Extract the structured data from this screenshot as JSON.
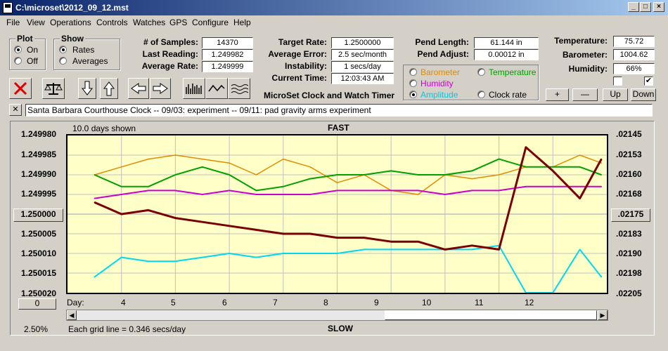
{
  "window": {
    "title": "C:\\microset\\2012_09_12.mst"
  },
  "menu": [
    "File",
    "View",
    "Operations",
    "Controls",
    "Watches",
    "GPS",
    "Configure",
    "Help"
  ],
  "plot_group": {
    "label": "Plot",
    "on": "On",
    "off": "Off",
    "selected": "On"
  },
  "show_group": {
    "label": "Show",
    "rates": "Rates",
    "averages": "Averages",
    "selected": "Rates"
  },
  "stats": {
    "samples_label": "# of Samples:",
    "samples": "14370",
    "last_label": "Last Reading:",
    "last": "1.249982",
    "avg_label": "Average Rate:",
    "avg": "1.249999"
  },
  "timing": {
    "target_label": "Target Rate:",
    "target": "1.2500000",
    "avg_err_label": "Average Error:",
    "avg_err": "2.5 sec/month",
    "instab_label": "Instability:",
    "instab": "1 secs/day",
    "time_label": "Current Time:",
    "time": "12:03:43 AM",
    "app_name": "MicroSet Clock and Watch Timer"
  },
  "pend": {
    "length_label": "Pend Length:",
    "length": "61.144 in",
    "adjust_label": "Pend Adjust:",
    "adjust": "0.00012 in"
  },
  "legend": {
    "barometer": "Barometer",
    "temperature": "Temperature",
    "humidity": "Humidity",
    "amplitude": "Amplitude",
    "clock_rate": "Clock rate",
    "colors": {
      "barometer": "#e08c00",
      "temperature": "#00a000",
      "humidity": "#cc00cc",
      "amplitude": "#00c8e0",
      "clock_rate": "#000000"
    }
  },
  "env": {
    "temp_label": "Temperature:",
    "temp": "75.72",
    "baro_label": "Barometer:",
    "baro": "1004.62",
    "hum_label": "Humidity:",
    "hum": "66%"
  },
  "scale_buttons": {
    "plus": "+",
    "minus": "—",
    "up": "Up",
    "down": "Down"
  },
  "notes": {
    "close": "✕",
    "text": "Santa Barbara Courthouse Clock  --  09/03: experiment  --  09/11: pad gravity arms experiment"
  },
  "plot": {
    "days_shown": "10.0 days shown",
    "fast": "FAST",
    "slow": "SLOW",
    "left_ticks": [
      "1.249980",
      "1.249985",
      "1.249990",
      "1.249995",
      "1.250000",
      "1.250005",
      "1.250010",
      "1.250015",
      "1.250020"
    ],
    "right_ticks": [
      ".02145",
      ".02153",
      ".02160",
      ".02168",
      ".02175",
      ".02183",
      ".02190",
      ".02198",
      ".02205"
    ],
    "center_left": "1.250000",
    "center_right": ".02175",
    "zero_btn": "0",
    "day_label": "Day:",
    "days": [
      "4",
      "5",
      "6",
      "7",
      "8",
      "9",
      "10",
      "11",
      "12"
    ],
    "zoom": "2.50%",
    "grid_note": "Each grid line = 0.346 secs/day",
    "colors": {
      "rate": "#7a0000",
      "barometer": "#e08c00",
      "temperature": "#00a000",
      "humidity": "#cc00cc",
      "amplitude": "#00d8f0",
      "bg": "#ffffc8"
    }
  },
  "chart_data": {
    "type": "line",
    "x": [
      3.5,
      4,
      4.5,
      5,
      5.5,
      6,
      6.5,
      7,
      7.5,
      8,
      8.5,
      9,
      9.5,
      10,
      10.5,
      11,
      11.5,
      12,
      12.5,
      12.9
    ],
    "series": [
      {
        "name": "Clock rate",
        "values": [
          1.249997,
          1.25,
          1.249999,
          1.250001,
          1.250002,
          1.250003,
          1.250004,
          1.250005,
          1.250005,
          1.250006,
          1.250006,
          1.250007,
          1.250007,
          1.250009,
          1.250008,
          1.250009,
          1.249983,
          1.249989,
          1.249996,
          1.249986
        ]
      },
      {
        "name": "Barometer",
        "values": [
          1.24999,
          1.249988,
          1.249986,
          1.249985,
          1.249986,
          1.249987,
          1.24999,
          1.249986,
          1.249988,
          1.249992,
          1.24999,
          1.249994,
          1.249995,
          1.24999,
          1.249991,
          1.24999,
          1.249988,
          1.249988,
          1.249985,
          1.249987
        ]
      },
      {
        "name": "Temperature",
        "values": [
          1.24999,
          1.249993,
          1.249993,
          1.24999,
          1.249988,
          1.24999,
          1.249994,
          1.249993,
          1.249991,
          1.24999,
          1.24999,
          1.249989,
          1.24999,
          1.24999,
          1.249989,
          1.249986,
          1.249988,
          1.249988,
          1.249988,
          1.24999
        ]
      },
      {
        "name": "Humidity",
        "values": [
          1.249996,
          1.249995,
          1.249994,
          1.249994,
          1.249995,
          1.249994,
          1.249995,
          1.249995,
          1.249995,
          1.249994,
          1.249994,
          1.249994,
          1.249994,
          1.249995,
          1.249994,
          1.249994,
          1.249993,
          1.249993,
          1.249993,
          1.249993
        ]
      },
      {
        "name": "Amplitude",
        "values": [
          1.250016,
          1.250011,
          1.250012,
          1.250012,
          1.250011,
          1.25001,
          1.250011,
          1.25001,
          1.25001,
          1.25001,
          1.250009,
          1.250009,
          1.250009,
          1.250009,
          1.250009,
          1.250008,
          1.25002,
          1.25002,
          1.250009,
          1.250016
        ]
      }
    ],
    "ylim": [
      1.24998,
      1.25002
    ],
    "xlim": [
      3.0,
      13.0
    ],
    "grid": true
  }
}
